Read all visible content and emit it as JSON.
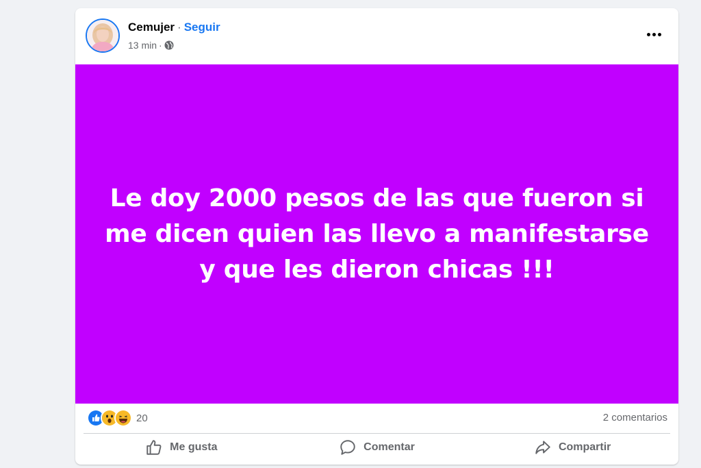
{
  "post": {
    "author": "Cemujer",
    "separator": "·",
    "follow_label": "Seguir",
    "time": "13 min",
    "time_separator": "·",
    "audience_icon": "globe-icon",
    "more_icon": "more-options-icon",
    "background_color": "#c100ff",
    "text": "Le doy 2000 pesos de las que fueron si me dicen quien las llevo a manifestarse y que les dieron chicas !!!"
  },
  "stats": {
    "reactions": [
      "like",
      "wow",
      "haha"
    ],
    "reaction_count": "20",
    "comments": "2 comentarios"
  },
  "actions": {
    "like_label": "Me gusta",
    "comment_label": "Comentar",
    "share_label": "Compartir"
  },
  "colors": {
    "accent": "#1877f2",
    "secondary_text": "#65676b"
  }
}
